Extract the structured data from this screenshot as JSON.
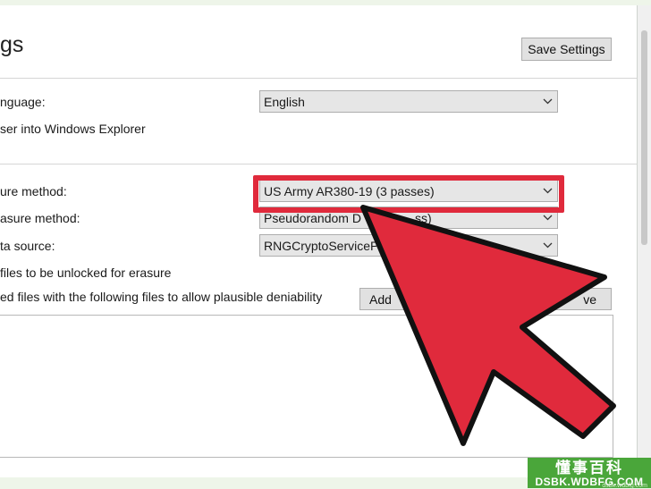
{
  "page": {
    "title": "gs",
    "save_button": "Save Settings"
  },
  "settings": {
    "language_label": "nguage:",
    "language_value": "English",
    "integrate_label": "ser into Windows Explorer",
    "erasure_method_label": "ure method:",
    "erasure_method_value": "US Army AR380-19 (3 passes)",
    "unused_erasure_label": "asure method:",
    "unused_erasure_value": "Pseudorandom D",
    "unused_erasure_suffix": "ss)",
    "data_source_label": "ta source:",
    "data_source_value": "RNGCryptoServiceP",
    "unlock_label": "files to be unlocked for erasure",
    "deniability_label": "ed files with the following files to allow plausible deniability",
    "add_button": "Add",
    "remove_button": "ve"
  },
  "overlay": {
    "highlight_color": "#e02a3c",
    "arrow_color": "#e02a3c"
  },
  "watermark": {
    "line1": "懂事百科",
    "line2": "DSBK.WDBFG.COM",
    "line3": "dsbk.wdbfg.com"
  }
}
